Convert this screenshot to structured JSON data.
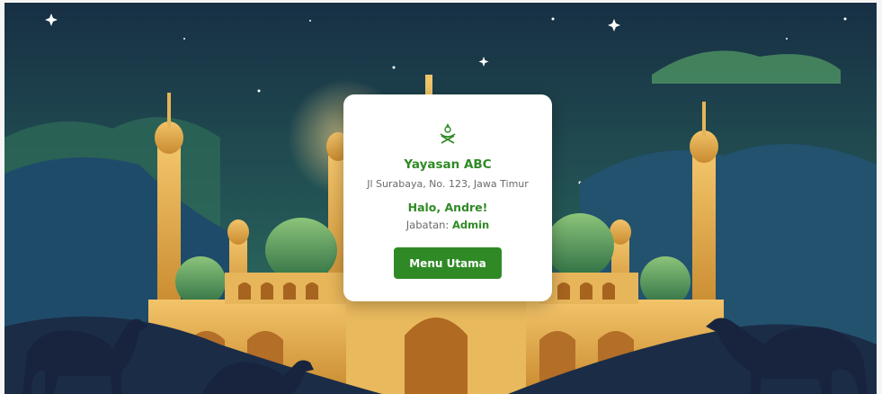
{
  "background": {
    "illustration": "mosque-night-scene",
    "icons": [
      "crescent-moon-icon",
      "star-icon",
      "camel-icon"
    ]
  },
  "card": {
    "logo_icon": "quran-stand-icon",
    "org_name": "Yayasan ABC",
    "address": "Jl Surabaya, No. 123, Jawa Timur",
    "greeting": "Halo, Andre!",
    "role_label": "Jabatan:",
    "role_value": "Admin",
    "button_label": "Menu Utama"
  },
  "colors": {
    "accent": "#2f8a25",
    "sky_top": "#16324a",
    "sky_bottom": "#2d6b5a",
    "gold": "#d9a542",
    "dome_green": "#3b8a4f",
    "silhouette": "#1e2e4a"
  }
}
